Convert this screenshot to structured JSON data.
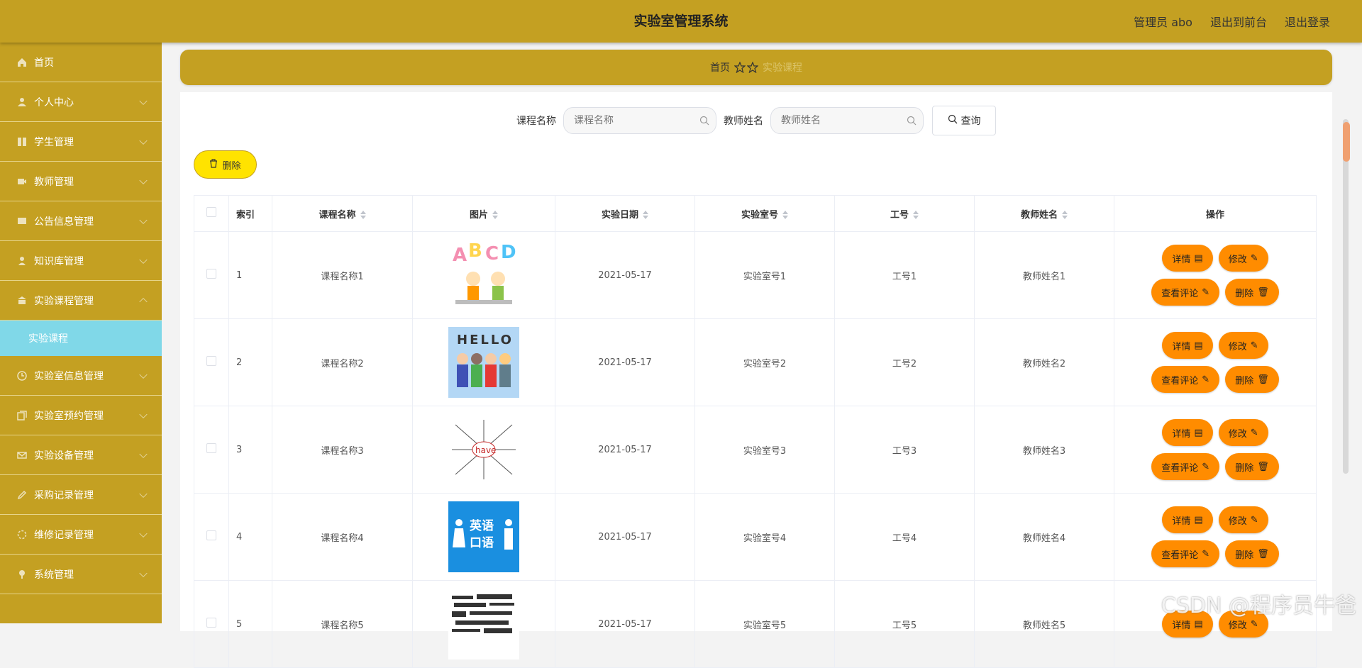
{
  "header": {
    "title": "实验室管理系统",
    "admin": "管理员 abo",
    "to_front": "退出到前台",
    "logout": "退出登录"
  },
  "sidebar": {
    "items": [
      {
        "label": "首页",
        "icon": "home-icon"
      },
      {
        "label": "个人中心",
        "icon": "user-icon"
      },
      {
        "label": "学生管理",
        "icon": "grid-icon"
      },
      {
        "label": "教师管理",
        "icon": "video-icon"
      },
      {
        "label": "公告信息管理",
        "icon": "message-icon"
      },
      {
        "label": "知识库管理",
        "icon": "person-icon"
      },
      {
        "label": "实验课程管理",
        "icon": "bank-icon"
      },
      {
        "label": "实验室信息管理",
        "icon": "clock-icon"
      },
      {
        "label": "实验室预约管理",
        "icon": "copy-icon"
      },
      {
        "label": "实验设备管理",
        "icon": "mail-icon"
      },
      {
        "label": "采购记录管理",
        "icon": "pencil-icon"
      },
      {
        "label": "维修记录管理",
        "icon": "circle-icon"
      },
      {
        "label": "系统管理",
        "icon": "pin-icon"
      }
    ],
    "active_sub": "实验课程"
  },
  "breadcrumb": {
    "home": "首页",
    "current": "实验课程"
  },
  "search": {
    "course_label": "课程名称",
    "course_placeholder": "课程名称",
    "teacher_label": "教师姓名",
    "teacher_placeholder": "教师姓名",
    "query": "查询"
  },
  "toolbar": {
    "delete": "删除"
  },
  "table": {
    "headers": [
      "索引",
      "课程名称",
      "图片",
      "实验日期",
      "实验室号",
      "工号",
      "教师姓名",
      "操作"
    ],
    "rows": [
      {
        "index": "1",
        "course": "课程名称1",
        "date": "2021-05-17",
        "lab": "实验室号1",
        "job": "工号1",
        "teacher": "教师姓名1",
        "image": "abcd-kids"
      },
      {
        "index": "2",
        "course": "课程名称2",
        "date": "2021-05-17",
        "lab": "实验室号2",
        "job": "工号2",
        "teacher": "教师姓名2",
        "image": "hello-kids"
      },
      {
        "index": "3",
        "course": "课程名称3",
        "date": "2021-05-17",
        "lab": "实验室号3",
        "job": "工号3",
        "teacher": "教师姓名3",
        "image": "have-mindmap"
      },
      {
        "index": "4",
        "course": "课程名称4",
        "date": "2021-05-17",
        "lab": "实验室号4",
        "job": "工号4",
        "teacher": "教师姓名4",
        "image": "english-speaking"
      },
      {
        "index": "5",
        "course": "课程名称5",
        "date": "2021-05-17",
        "lab": "实验室号5",
        "job": "工号5",
        "teacher": "教师姓名5",
        "image": "word-cloud"
      }
    ],
    "actions": {
      "detail": "详情",
      "edit": "修改",
      "comments": "查看评论",
      "delete": "删除"
    },
    "img4_text": [
      "英语",
      "口语"
    ],
    "img3_text": "have",
    "img2_text": "HELLO",
    "img1_text": [
      "A",
      "B",
      "C",
      "D"
    ]
  },
  "watermark": "CSDN @程序员牛爸",
  "colors": {
    "primary": "#c4a022",
    "accent": "#ff8c00",
    "active": "#80d8e8"
  }
}
